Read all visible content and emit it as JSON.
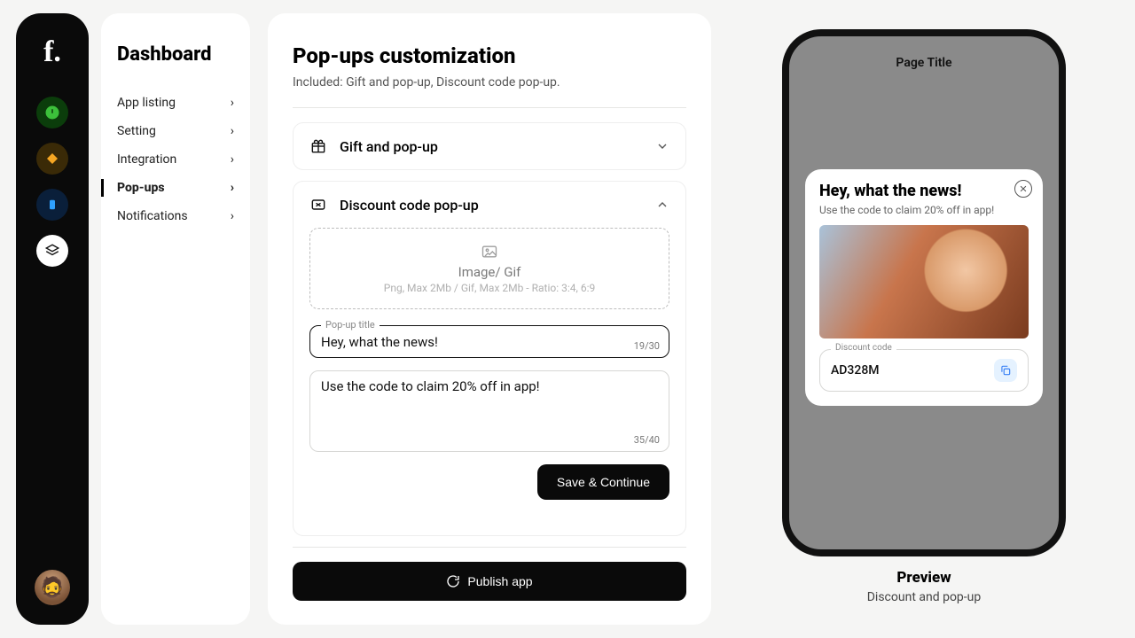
{
  "rail": {
    "logo": "f."
  },
  "sidebar": {
    "title": "Dashboard",
    "items": [
      {
        "label": "App listing",
        "active": false
      },
      {
        "label": "Setting",
        "active": false
      },
      {
        "label": "Integration",
        "active": false
      },
      {
        "label": "Pop-ups",
        "active": true
      },
      {
        "label": "Notifications",
        "active": false
      }
    ]
  },
  "main": {
    "title": "Pop-ups customization",
    "subtitle": "Included: Gift and pop-up, Discount code pop-up.",
    "accordion1": "Gift and pop-up",
    "accordion2": "Discount code pop-up",
    "dropzone": {
      "title": "Image/ Gif",
      "sub": "Png, Max 2Mb / Gif, Max 2Mb - Ratio: 3:4, 6:9"
    },
    "title_field": {
      "label": "Pop-up title",
      "value": "Hey, what the news!",
      "counter": "19/30"
    },
    "body_field": {
      "value": "Use the code to claim 20% off in app!",
      "counter": "35/40"
    },
    "save_btn": "Save & Continue",
    "publish_btn": "Publish app"
  },
  "preview": {
    "page_title": "Page Title",
    "popup_title": "Hey, what the news!",
    "popup_body": "Use the code to claim 20% off in app!",
    "code_label": "Discount code",
    "code_value": "AD328M",
    "label": "Preview",
    "sub": "Discount and pop-up"
  }
}
